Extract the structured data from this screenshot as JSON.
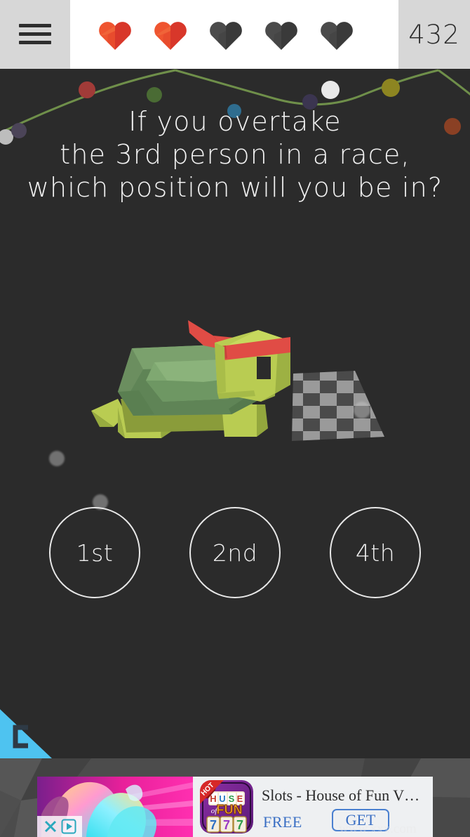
{
  "topbar": {
    "menu_icon": "hamburger-menu-icon",
    "score": "432",
    "lives": [
      {
        "state": "full",
        "color": "#e8452c"
      },
      {
        "state": "full",
        "color": "#e8452c"
      },
      {
        "state": "empty",
        "color": "#3f3f3f"
      },
      {
        "state": "empty",
        "color": "#3f3f3f"
      },
      {
        "state": "empty",
        "color": "#3f3f3f"
      }
    ],
    "bg_side": "#d7d7d7",
    "bg_center": "#ffffff"
  },
  "question": {
    "line1": "If you overtake",
    "line2": "the 3rd person in a race,",
    "line3": "which position will you be in?",
    "text_color": "#f2f2f2"
  },
  "illustration": {
    "character": "turtle-with-red-headband",
    "track": "checkered-finish-line",
    "shell_color": "#5d8557",
    "body_color": "#b9cc52",
    "headband_color": "#e04c45"
  },
  "answers": [
    {
      "label": "1st"
    },
    {
      "label": "2nd"
    },
    {
      "label": "4th"
    }
  ],
  "garland": {
    "bulbs": [
      {
        "color": "#bdbdbd"
      },
      {
        "color": "#4b4458"
      },
      {
        "color": "#a13b38"
      },
      {
        "color": "#4a6b34"
      },
      {
        "color": "#2f6d8f"
      },
      {
        "color": "#3b3550"
      },
      {
        "color": "#e9e9e9"
      },
      {
        "color": "#8d8521"
      },
      {
        "color": "#8a4024"
      }
    ],
    "wire_color": "#6f8f4a"
  },
  "recorder_badge": {
    "name": "screen-recorder-badge",
    "color": "#4ec3f0"
  },
  "ad": {
    "title": "Slots - House of Fun V…",
    "free_label": "FREE",
    "get_label": "GET",
    "close_icon": "close-x-icon",
    "adchoices_icon": "adchoices-icon",
    "icon_ribbon": "HOT",
    "icon_title_top": "HOUSE",
    "icon_title_mid": "of",
    "icon_title_bottom": "FUN",
    "icon_reel": "7",
    "watermark": "www.xxx.com",
    "accent": "#3a6fc4",
    "bg": "#eef0f2"
  },
  "app_bg": "#2b2b2b"
}
